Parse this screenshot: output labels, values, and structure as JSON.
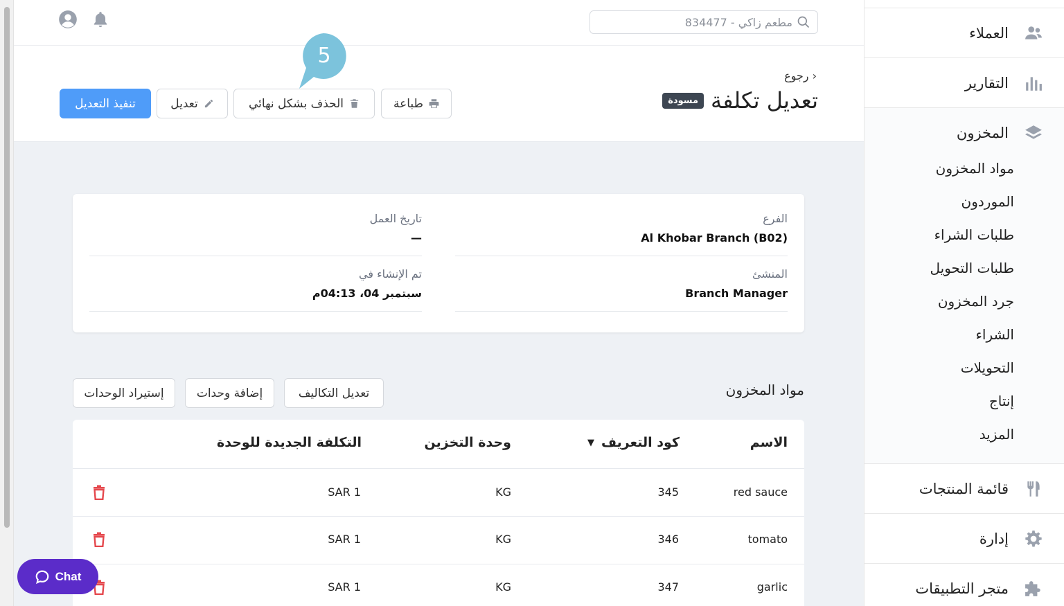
{
  "header": {
    "search_placeholder": "مطعم زاكي - 834477",
    "icons": [
      "search-icon",
      "bell-icon",
      "user-icon"
    ]
  },
  "page": {
    "back_label": "رجوع",
    "title": "تعديل تكلفة",
    "status_badge": "مسودة",
    "tooltip_number": "5",
    "actions": {
      "print": "طباعة",
      "delete_permanent": "الحذف بشكل نهائي",
      "edit": "تعديل",
      "apply": "تنفيذ التعديل"
    }
  },
  "details": {
    "branch_label": "الفرع",
    "branch_value": "Al Khobar Branch (B02)",
    "business_date_label": "تاريخ العمل",
    "business_date_value": "—",
    "creator_label": "المنشئ",
    "creator_value": "Branch Manager",
    "created_at_label": "تم الإنشاء في",
    "created_at_value": "سبتمبر 04، 04:13م"
  },
  "items_section": {
    "title": "مواد المخزون",
    "buttons": {
      "edit_costs": "تعديل التكاليف",
      "add_units": "إضافة وحدات",
      "import_units": "إستيراد الوحدات"
    },
    "columns": {
      "name": "الاسم",
      "sku": "كود التعريف",
      "storage_unit": "وحدة التخزين",
      "new_cost": "التكلفة الجديدة للوحدة"
    },
    "rows": [
      {
        "name": "red sauce",
        "sku": "345",
        "unit": "KG",
        "cost": "SAR 1"
      },
      {
        "name": "tomato",
        "sku": "346",
        "unit": "KG",
        "cost": "SAR 1"
      },
      {
        "name": "garlic",
        "sku": "347",
        "unit": "KG",
        "cost": "SAR 1"
      }
    ]
  },
  "sidebar": {
    "customers": "العملاء",
    "reports": "التقارير",
    "inventory": "المخزون",
    "inventory_sub": [
      "مواد المخزون",
      "الموردون",
      "طلبات الشراء",
      "طلبات التحويل",
      "جرد المخزون",
      "الشراء",
      "التحويلات",
      "إنتاج",
      "المزيد"
    ],
    "menu": "قائمة المنتجات",
    "manage": "إدارة",
    "marketplace": "متجر التطبيقات"
  },
  "chat": {
    "label": "Chat"
  },
  "colors": {
    "primary": "#4f9cf9",
    "delete": "#e5484d",
    "chat": "#5b2cc9",
    "tooltip": "#7cc3dc"
  }
}
